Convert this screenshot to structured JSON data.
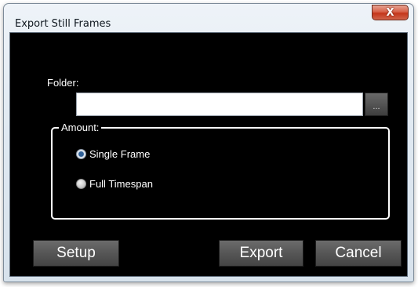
{
  "window": {
    "title": "Export Still Frames",
    "close_glyph": "X"
  },
  "folder": {
    "label": "Folder:",
    "value": "",
    "browse_label": "..."
  },
  "amount": {
    "legend": "Amount:",
    "options": [
      {
        "label": "Single Frame",
        "selected": true
      },
      {
        "label": "Full Timespan",
        "selected": false
      }
    ]
  },
  "buttons": {
    "setup": "Setup",
    "export": "Export",
    "cancel": "Cancel"
  },
  "colors": {
    "client_background": "#000000",
    "text": "#ffffff",
    "button_face": "#565656",
    "close_button": "#c4361a"
  },
  "icons": {
    "close": "close-icon"
  }
}
